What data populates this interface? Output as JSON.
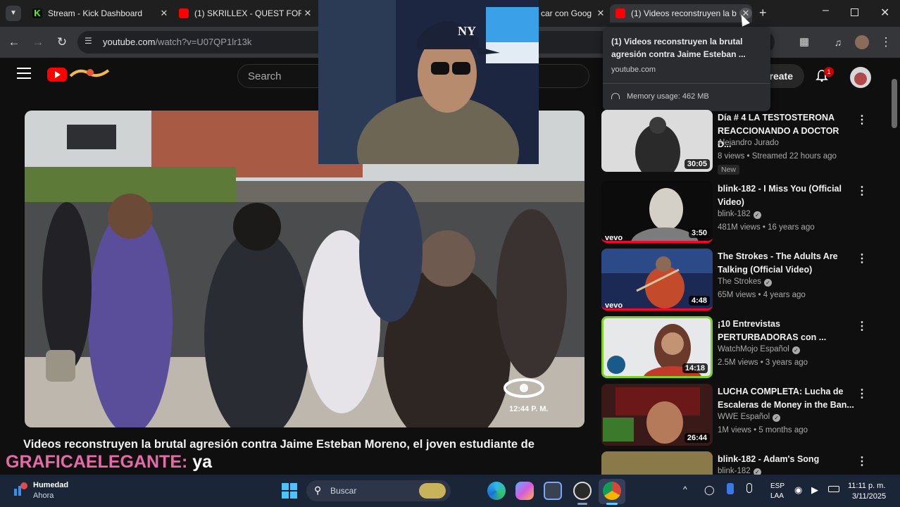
{
  "tabs": [
    {
      "title": "Stream - Kick Dashboard",
      "favicon": "kick-icon",
      "color": "#53fc18"
    },
    {
      "title": "(1) SKRILLEX - QUEST FOR FI",
      "favicon": "youtube-icon",
      "color": "#ff0000"
    },
    {
      "title": "car con Goog",
      "favicon": "",
      "color": ""
    },
    {
      "title": "(1) Videos reconstruyen la b",
      "favicon": "youtube-icon",
      "color": "#ff0000"
    }
  ],
  "address": {
    "host": "youtube.com",
    "path": "/watch?v=U07QP1lr13k"
  },
  "hover_card": {
    "title": "(1) Videos reconstruyen la brutal agresión contra Jaime Esteban ...",
    "domain": "youtube.com",
    "memory": "Memory usage: 462 MB"
  },
  "youtube": {
    "search_placeholder": "Search",
    "create_label": "reate",
    "notif_count": "1"
  },
  "video": {
    "title": "Videos reconstruyen la brutal agresión contra Jaime Esteban Moreno, el joven estudiante de",
    "clock": "12:44 P. M."
  },
  "chat_overlay": {
    "user": "GRAFICAELEGANTE:",
    "message": "ya"
  },
  "recommendations": [
    {
      "title": "Día # 4 LA TESTOSTERONA REACCIONANDO A DOCTOR D...",
      "channel": "Alejandro Jurado",
      "verified": false,
      "meta": "8 views • Streamed 22 hours ago",
      "badge": "New",
      "duration": "30:05"
    },
    {
      "title": "blink-182 - I Miss You (Official Video)",
      "channel": "blink-182",
      "verified": true,
      "meta": "481M views • 16 years ago",
      "badge": "",
      "duration": "3:50"
    },
    {
      "title": "The Strokes - The Adults Are Talking (Official Video)",
      "channel": "The Strokes",
      "verified": true,
      "meta": "65M views • 4 years ago",
      "badge": "",
      "duration": "4:48"
    },
    {
      "title": "¡10 Entrevistas PERTURBADORAS con ...",
      "channel": "WatchMojo Español",
      "verified": true,
      "meta": "2.5M views • 3 years ago",
      "badge": "",
      "duration": "14:18"
    },
    {
      "title": "LUCHA COMPLETA: Lucha de Escaleras de Money in the Ban...",
      "channel": "WWE Español",
      "verified": true,
      "meta": "1M views • 5 months ago",
      "badge": "",
      "duration": "26:44"
    },
    {
      "title": "blink-182 - Adam's Song",
      "channel": "blink-182",
      "verified": true,
      "meta": "",
      "badge": "",
      "duration": ""
    }
  ],
  "taskbar": {
    "weather_title": "Humedad",
    "weather_sub": "Ahora",
    "search_label": "Buscar",
    "lang_top": "ESP",
    "lang_bottom": "LAA",
    "time": "11:11 p. m.",
    "date": "3/11/2025"
  }
}
